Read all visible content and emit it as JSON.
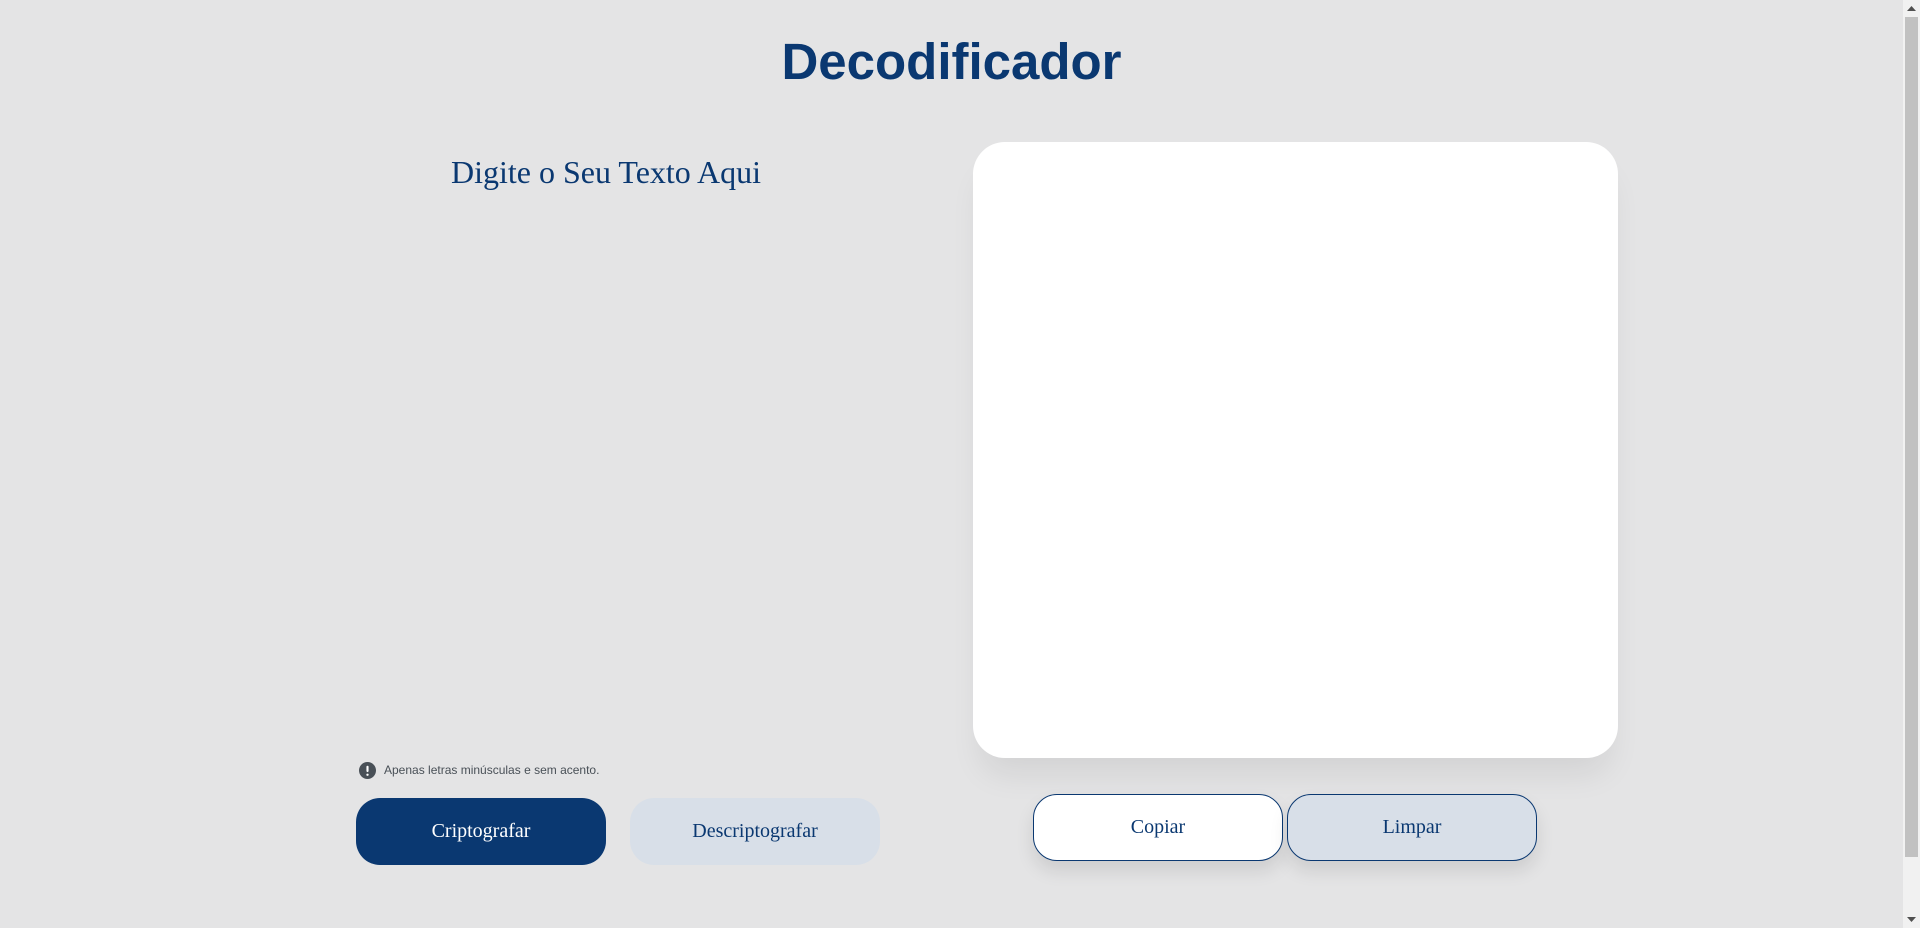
{
  "header": {
    "title": "Decodificador"
  },
  "input": {
    "placeholder": "Digite o Seu Texto Aqui",
    "value": ""
  },
  "hint": {
    "icon": "exclamation-circle-icon",
    "text": "Apenas letras minúsculas e sem acento."
  },
  "actions": {
    "encrypt_label": "Criptografar",
    "decrypt_label": "Descriptografar"
  },
  "output": {
    "value": "",
    "copy_label": "Copiar",
    "clear_label": "Limpar"
  },
  "colors": {
    "background": "#e4e4e5",
    "primary": "#0a3871",
    "secondary_button": "#d8dfe8",
    "panel": "#ffffff",
    "hint_text": "#495057"
  }
}
